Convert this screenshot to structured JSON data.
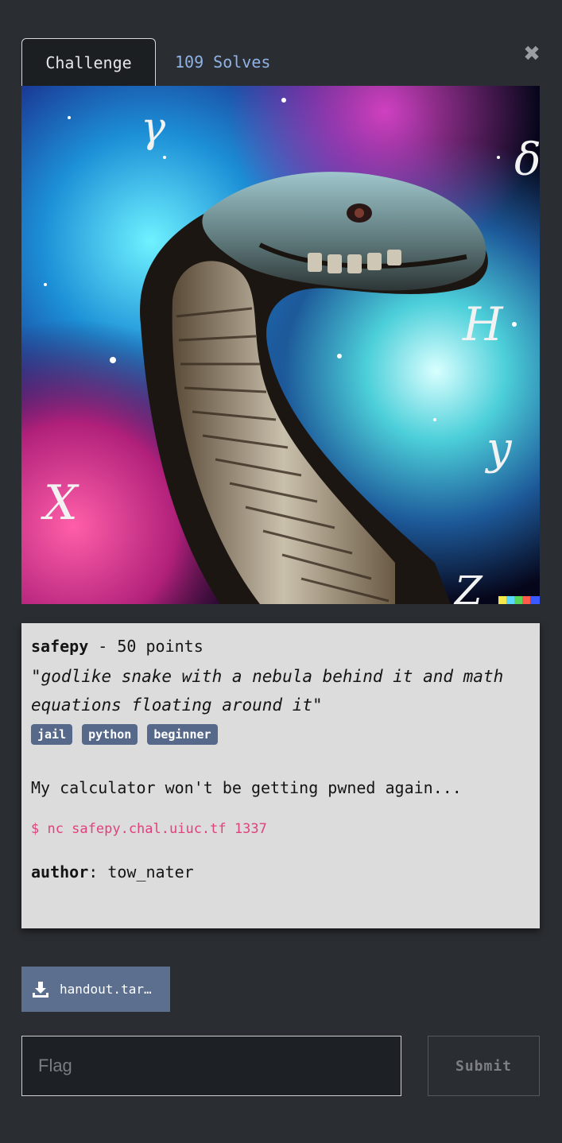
{
  "tabs": {
    "challenge": "Challenge",
    "solves": "109 Solves"
  },
  "close_icon": "close-icon",
  "challenge": {
    "name": "safepy",
    "points_text": " - 50 points",
    "quote": "\"godlike snake with a nebula behind it and math equations floating around it\"",
    "tags": [
      "jail",
      "python",
      "beginner"
    ],
    "description": "My calculator won't be getting pwned again...",
    "command": "$ nc safepy.chal.uiuc.tf 1337",
    "author_label": "author",
    "author_sep": ": ",
    "author_value": "tow_nater"
  },
  "image": {
    "symbols": [
      "𝛾",
      "δ",
      "H",
      "X",
      "y",
      "Z"
    ]
  },
  "download": {
    "icon": "download-icon",
    "filename": "handout.tar.gz"
  },
  "flag": {
    "placeholder": "Flag",
    "value": ""
  },
  "submit_label": "Submit",
  "colors": {
    "background": "#2a2d31",
    "tab_link": "#8fb3e6",
    "tag": "#56698a",
    "command": "#e0407c",
    "download": "#5c6f8f"
  }
}
